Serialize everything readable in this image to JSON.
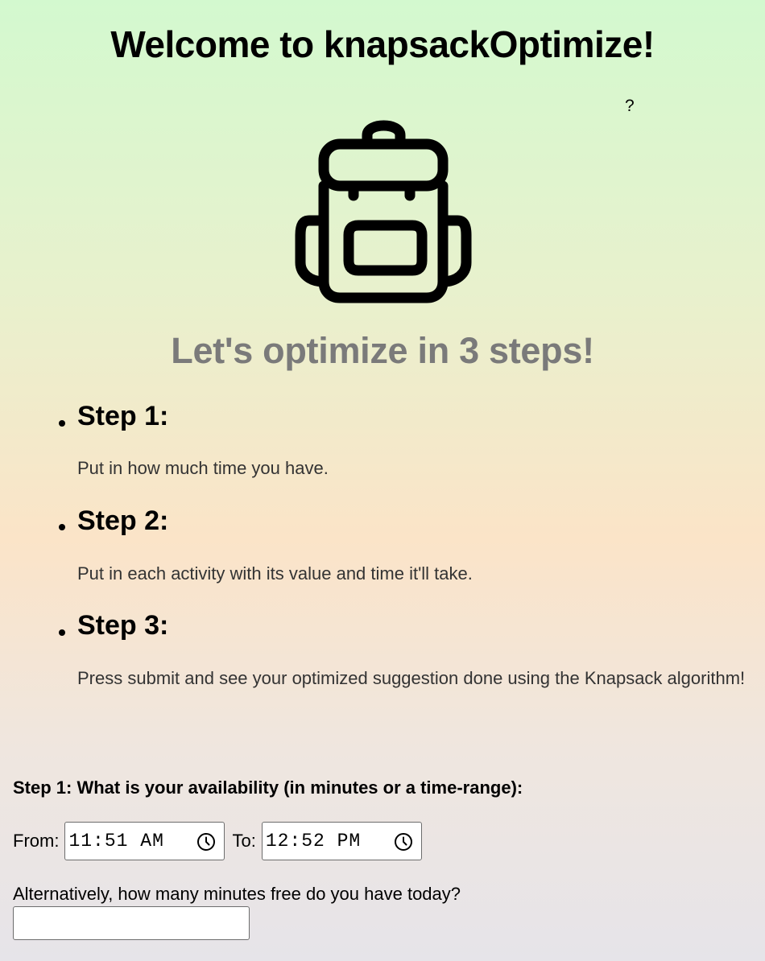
{
  "header": {
    "title": "Welcome to knapsackOptimize!",
    "help_label": "?"
  },
  "logo": {
    "icon": "backpack-icon",
    "color": "#000000"
  },
  "intro": {
    "subtitle": "Let's optimize in 3 steps!",
    "steps": [
      {
        "title": "Step 1:",
        "description": "Put in how much time you have."
      },
      {
        "title": "Step 2:",
        "description": "Put in each activity with its value and time it'll take."
      },
      {
        "title": "Step 3:",
        "description": "Press submit and see your optimized suggestion done using the Knapsack algorithm!"
      }
    ]
  },
  "availability_form": {
    "heading": "Step 1: What is your availability (in minutes or a time-range):",
    "from_label": "From:",
    "from_value": "11:51 AM",
    "to_label": "To:",
    "to_value": "12:52 PM",
    "clock_icon": "clock-icon",
    "minutes_label": "Alternatively, how many minutes free do you have today?",
    "minutes_value": ""
  },
  "colors": {
    "subtitle": "#7a7a7a",
    "gradient_top": "#d3f9cf",
    "gradient_mid": "#fbe4c8",
    "gradient_bottom": "#e6e4e9"
  }
}
